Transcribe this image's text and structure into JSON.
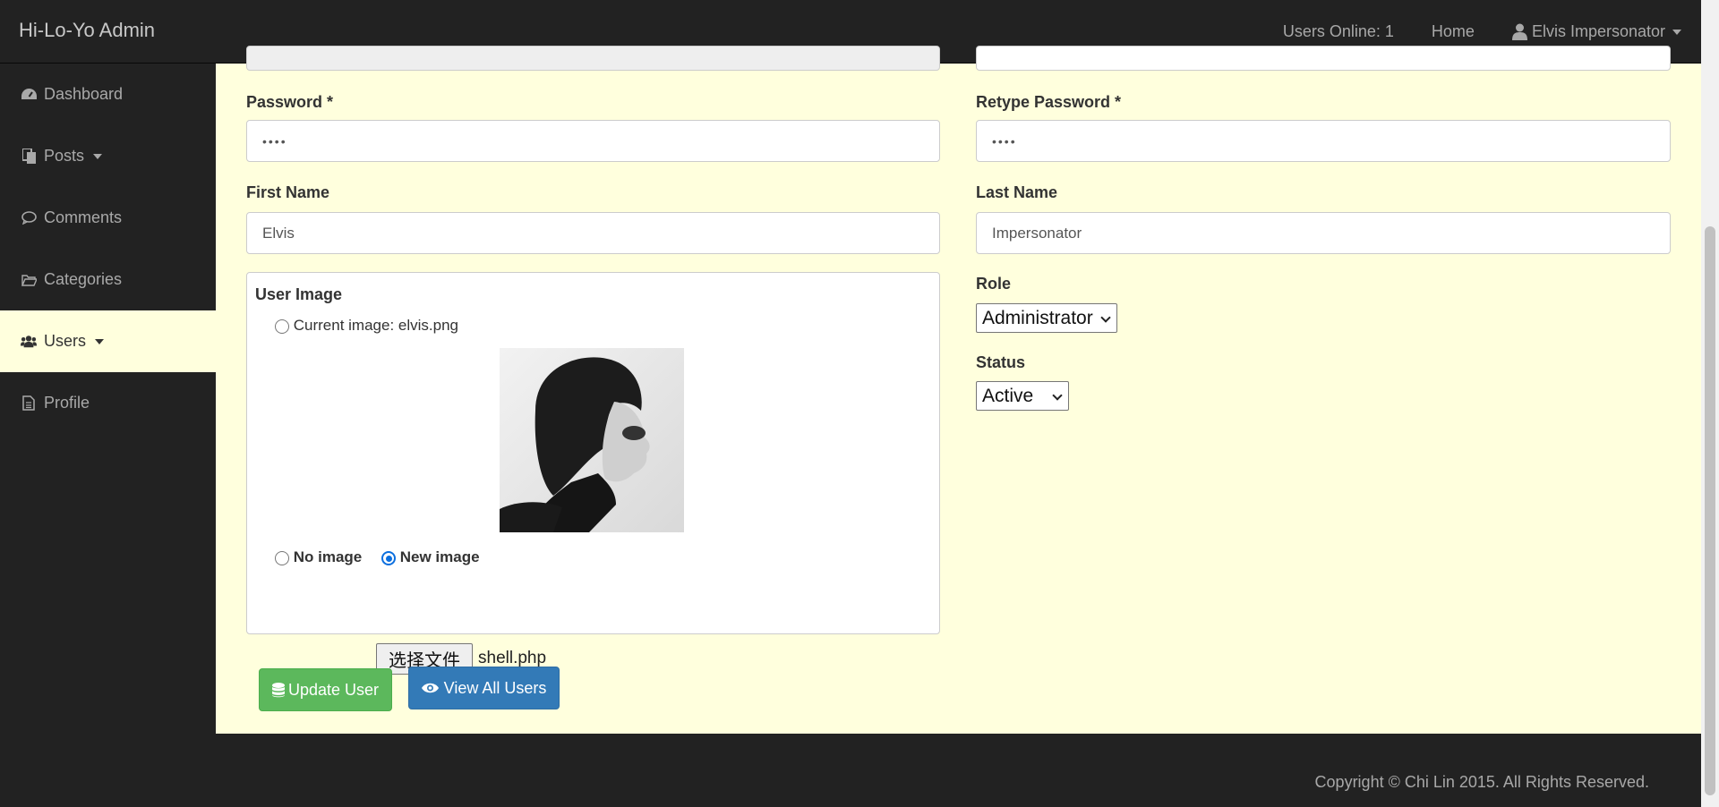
{
  "navbar": {
    "brand": "Hi-Lo-Yo Admin",
    "users_online": "Users Online: 1",
    "home": "Home",
    "user_name": "Elvis Impersonator"
  },
  "sidebar": {
    "items": [
      {
        "label": "Dashboard",
        "icon": "dashboard-icon"
      },
      {
        "label": "Posts",
        "icon": "posts-icon"
      },
      {
        "label": "Comments",
        "icon": "comment-icon"
      },
      {
        "label": "Categories",
        "icon": "folder-icon"
      },
      {
        "label": "Users",
        "icon": "users-icon"
      },
      {
        "label": "Profile",
        "icon": "file-icon"
      }
    ]
  },
  "form": {
    "password_label": "Password *",
    "password_value": "••••",
    "retype_password_label": "Retype Password *",
    "retype_password_value": "••••",
    "first_name_label": "First Name",
    "first_name_value": "Elvis",
    "last_name_label": "Last Name",
    "last_name_value": "Impersonator",
    "user_image_label": "User Image",
    "current_image_label": "Current image: elvis.png",
    "no_image_label": "No image",
    "new_image_label": "New image",
    "choose_file_label": "选择文件",
    "chosen_file": "shell.php",
    "role_label": "Role",
    "role_value": "Administrator",
    "status_label": "Status",
    "status_value": "Active",
    "update_button": "Update User",
    "view_all_button": "View All Users"
  },
  "footer": {
    "copyright": "Copyright © Chi Lin 2015. All Rights Reserved."
  },
  "colors": {
    "navbar_bg": "#222222",
    "content_bg": "#ffffdd",
    "btn_green": "#5cb85c",
    "btn_blue": "#337ab7"
  }
}
